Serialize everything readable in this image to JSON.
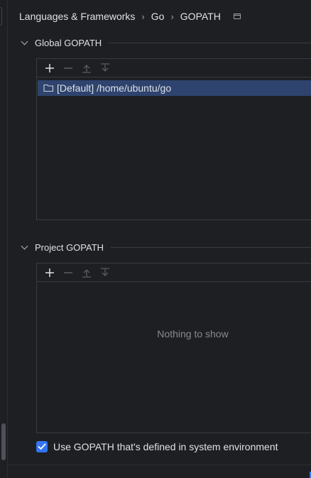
{
  "breadcrumb": {
    "items": [
      "Languages & Frameworks",
      "Go",
      "GOPATH"
    ],
    "separator": "›"
  },
  "global_gopath": {
    "title": "Global GOPATH",
    "entries": [
      {
        "label": "[Default] /home/ubuntu/go",
        "selected": true
      }
    ]
  },
  "project_gopath": {
    "title": "Project GOPATH",
    "empty_text": "Nothing to show"
  },
  "toolbar": {
    "icons": [
      "add-icon",
      "remove-icon",
      "move-up-icon",
      "move-down-icon"
    ]
  },
  "system_env_checkbox": {
    "label": "Use GOPATH that's defined in system environment",
    "checked": true
  },
  "colors": {
    "background": "#1e1f22",
    "selection": "#2e436e",
    "accent": "#3574f0",
    "border": "#393b40"
  }
}
